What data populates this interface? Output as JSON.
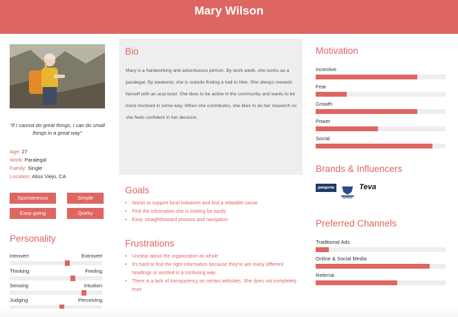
{
  "header": {
    "name": "Mary Wilson"
  },
  "profile": {
    "quote": "\"If I cannot do great things, I can do small things in a great way\"",
    "facts": [
      {
        "label": "Age:",
        "value": "27"
      },
      {
        "label": "Work:",
        "value": "Paralegal"
      },
      {
        "label": "Family:",
        "value": "Single"
      },
      {
        "label": "Location:",
        "value": "Aliso Viejo, CA"
      }
    ],
    "traits": [
      "Spontaneous",
      "Simple",
      "Easy-going",
      "Quirky"
    ]
  },
  "personality": {
    "title": "Personality",
    "scales": [
      {
        "left": "Introvert",
        "right": "Extrovert",
        "level": 0.62
      },
      {
        "left": "Thinking",
        "right": "Feeling",
        "level": 0.68
      },
      {
        "left": "Sensing",
        "right": "Intuition",
        "level": 0.8
      },
      {
        "left": "Judging",
        "right": "Perceiving",
        "level": 0.56
      }
    ]
  },
  "bio": {
    "title": "Bio",
    "text": "Mary is a hardworking and adventurous person. By work week, she works as a paralegal. By weekend, she is outside finding a trail to hike. She always rewards herself with an acai bowl. She likes to be active in the community and wants to be more involved in some way. When she contributes, she likes to do her research so she feels confident in her decision."
  },
  "goals": {
    "title": "Goals",
    "items": [
      "Wants to support local initiatives and find a relatable cause",
      "Find the information she is looking for easily",
      "Easy, straightforward process and navigation"
    ]
  },
  "frustrations": {
    "title": "Frustrations",
    "items": [
      "Unclear about the organization as whole",
      "It's hard to find the right information because they're are many different headings or worded in a confusing way",
      "There is a lack of transparency on certain websites. She does not completely trust"
    ]
  },
  "motivation": {
    "title": "Motivation",
    "items": [
      {
        "label": "Incentive",
        "level": 0.78
      },
      {
        "label": "Fear",
        "level": 0.24
      },
      {
        "label": "Growth",
        "level": 0.78
      },
      {
        "label": "Power",
        "level": 0.48
      },
      {
        "label": "Social",
        "level": 0.9
      }
    ]
  },
  "brands": {
    "title": "Brands & Influencers",
    "logos": [
      {
        "text": "patagonia",
        "icon": "patagonia-logo"
      },
      {
        "text": "",
        "icon": "crest-logo"
      },
      {
        "text": "Teva",
        "icon": "teva-logo"
      }
    ]
  },
  "channels": {
    "title": "Preferred Channels",
    "items": [
      {
        "label": "Traditional Ads",
        "level": 0.1
      },
      {
        "label": "Online & Social Media",
        "level": 0.88
      },
      {
        "label": "Referral",
        "level": 0.63
      }
    ]
  },
  "colors": {
    "accent": "#dd6661",
    "track": "#eeeeee"
  }
}
